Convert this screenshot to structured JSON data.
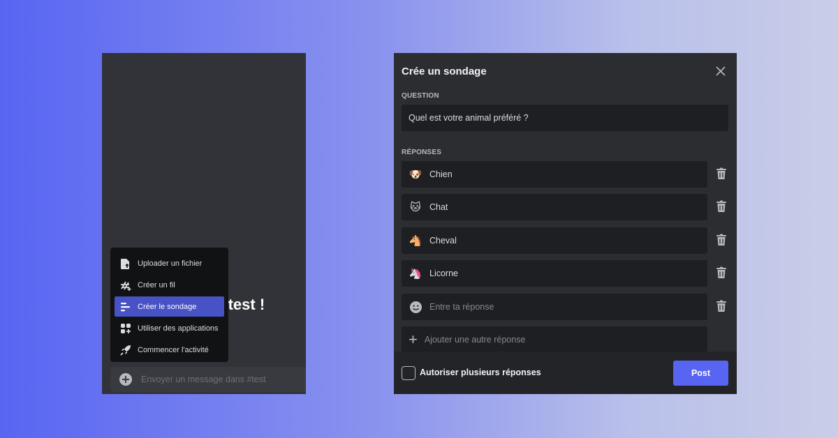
{
  "left_panel": {
    "welcome_visible": "s #test !",
    "menu": [
      {
        "label": "Uploader un fichier",
        "icon": "upload-file-icon"
      },
      {
        "label": "Créer un fil",
        "icon": "thread-icon"
      },
      {
        "label": "Créer le sondage",
        "icon": "poll-icon",
        "active": true
      },
      {
        "label": "Utiliser des applications",
        "icon": "apps-icon"
      },
      {
        "label": "Commencer l'activité",
        "icon": "rocket-icon"
      }
    ],
    "message_placeholder": "Envoyer un message dans #test"
  },
  "modal": {
    "title": "Crée un sondage",
    "question_label": "QUESTION",
    "question_value": "Quel est votre animal préféré ?",
    "answers_label": "RÉPONSES",
    "answers": [
      {
        "emoji": "🐶",
        "text": "Chien"
      },
      {
        "emoji": "🐱",
        "text": "Chat"
      },
      {
        "emoji": "🐴",
        "text": "Cheval"
      },
      {
        "emoji": "🦄",
        "text": "Licorne"
      }
    ],
    "answer_placeholder": "Entre ta réponse",
    "add_answer_label": "Ajouter une autre réponse",
    "multi_label": "Autoriser plusieurs réponses",
    "post_label": "Post"
  },
  "colors": {
    "accent": "#5865f2",
    "active_menu": "#4752c4",
    "panel_bg": "#2b2d31",
    "input_bg": "#1e1f22"
  }
}
